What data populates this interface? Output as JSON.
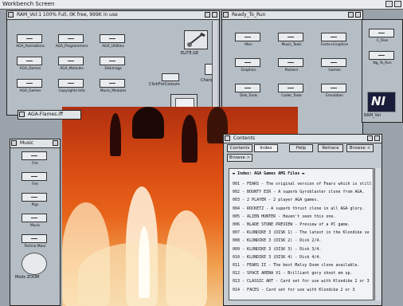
{
  "screen": {
    "title": "Workbench Screen"
  },
  "win_main": {
    "title": "RAM_Vol:1   100% Full, 0K free, 999K in use",
    "icons": [
      {
        "label": "AGA_Animations"
      },
      {
        "label": "AGA_Programmers"
      },
      {
        "label": "AGA_Utilities"
      },
      {
        "label": "AGA_Demos"
      },
      {
        "label": "AGA_Modules"
      },
      {
        "label": "Diskmags"
      },
      {
        "label": "AGA_Games"
      },
      {
        "label": "Copyrights-Info"
      },
      {
        "label": "Music_Modules"
      }
    ],
    "tools": [
      {
        "label": "ELITE.GE"
      },
      {
        "label": "ClickForColours"
      },
      {
        "label": "Change"
      }
    ]
  },
  "win_ready": {
    "title": "Ready_To_Run",
    "icons": [
      {
        "label": "Misc"
      },
      {
        "label": "Music_Tools"
      },
      {
        "label": "Fonts+Graphics"
      },
      {
        "label": "Graphics"
      },
      {
        "label": "Packers"
      },
      {
        "label": "Games"
      },
      {
        "label": "Disk_Tools"
      },
      {
        "label": "Coder_Tools"
      },
      {
        "label": "Emulation"
      }
    ]
  },
  "win_right": {
    "icons": [
      {
        "label": "C_Files"
      },
      {
        "label": "Ng_To_Run"
      }
    ],
    "badge": "NI",
    "badge_label": "RAM_Vol"
  },
  "win_flames": {
    "title": "AGA-Flames.iff"
  },
  "win_music": {
    "title": "Music",
    "icons": [
      {
        "label": "Fire"
      },
      {
        "label": "Fire"
      },
      {
        "label": "Pigs"
      },
      {
        "label": "Music"
      },
      {
        "label": "Techno Moor"
      }
    ],
    "tool_label": "Mods ZOOM"
  },
  "win_contents": {
    "title": "Contents",
    "buttons": [
      "Contents",
      "Index",
      "Help",
      "Retrace",
      "Browse <",
      "Browse >"
    ],
    "heading": "▬ Index: AGA Games AMG Files ▬",
    "lines": [
      "001 - FEARS - The original version of Fears which is still",
      "002 - BOUNTY EIR - A superb Gyroblaster clone from AGA.",
      "003 - 2 PLAYER - 2 player AGA games.",
      "004 - ROCKETZ - A superb thrust clone in all AGA glory.",
      "005 - ALIEN HUNTER - Haven't seen this one.",
      "006 - BLADE STONE PREVIEW - Preview of a PC game.",
      "007 - KLONDIKE 3 (DISK 1) - The latest in the Klondike se",
      "008 - KLONDIKE 3 (DISK 2) - Disk 2/4.",
      "009 - KLONDIKE 3 (DISK 3) - Disk 3/4.",
      "010 - KLONDIKE 3 (DISK 4) - Disk 4/4.",
      "011 - FEARS II - The best Malsy Doom clone available.",
      "012 - SPACE ARENA V1 - Brilliant gory shoot em up.",
      "013 - CLASSIC ART - Card set for use with Klondike 2 or 3",
      "014 - FACES - Card set for use with Klondike 2 or 3"
    ]
  }
}
